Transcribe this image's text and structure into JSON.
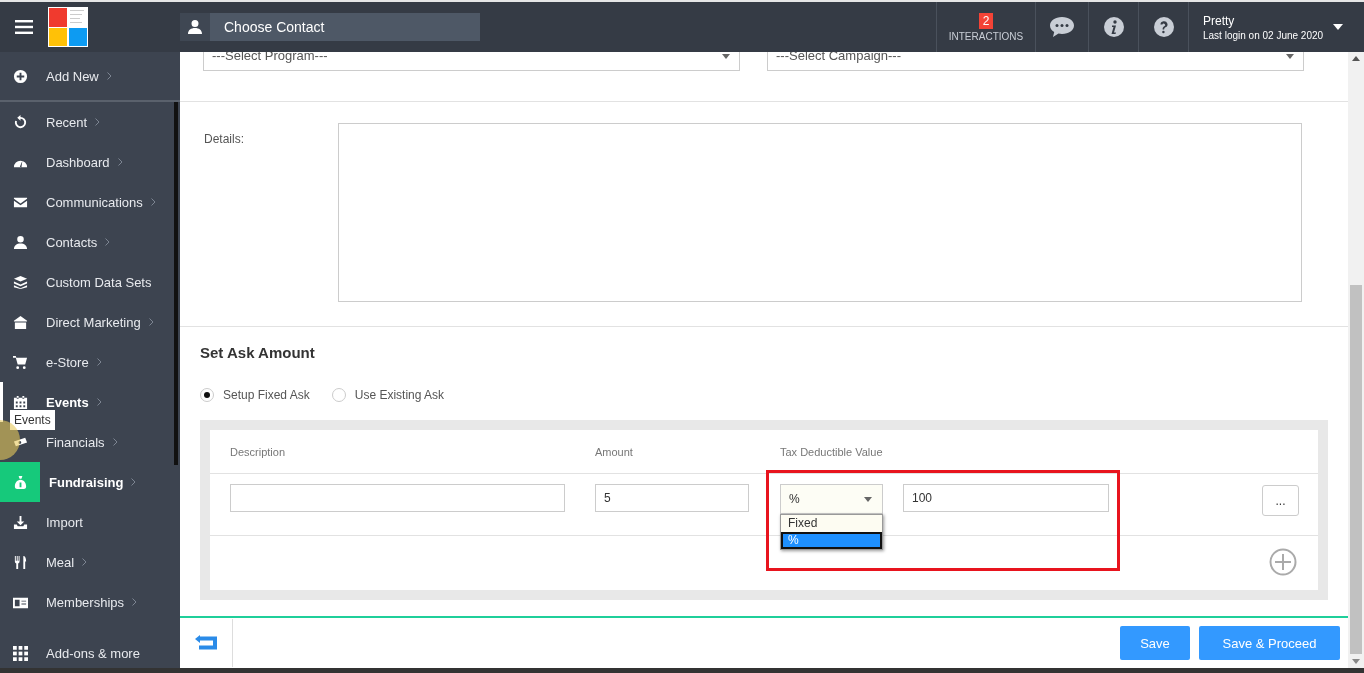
{
  "header": {
    "contact_placeholder": "Choose Contact",
    "interactions": {
      "count": "2",
      "label": "INTERACTIONS"
    },
    "user": {
      "name": "Pretty",
      "last_login": "Last login on 02 June 2020"
    }
  },
  "sidebar": {
    "items": [
      {
        "label": "Add New",
        "arrow": true,
        "selected": false,
        "hovered": false
      },
      {
        "label": "Recent",
        "arrow": true,
        "selected": false,
        "hovered": false
      },
      {
        "label": "Dashboard",
        "arrow": true,
        "selected": false,
        "hovered": false
      },
      {
        "label": "Communications",
        "arrow": true,
        "selected": false,
        "hovered": false
      },
      {
        "label": "Contacts",
        "arrow": true,
        "selected": false,
        "hovered": false
      },
      {
        "label": "Custom Data Sets",
        "arrow": false,
        "selected": false,
        "hovered": false
      },
      {
        "label": "Direct Marketing",
        "arrow": true,
        "selected": false,
        "hovered": false
      },
      {
        "label": "e-Store",
        "arrow": true,
        "selected": false,
        "hovered": false
      },
      {
        "label": "Events",
        "arrow": true,
        "selected": false,
        "hovered": true
      },
      {
        "label": "Financials",
        "arrow": true,
        "selected": false,
        "hovered": false
      },
      {
        "label": "Fundraising",
        "arrow": true,
        "selected": true,
        "hovered": false
      },
      {
        "label": "Import",
        "arrow": false,
        "selected": false,
        "hovered": false
      },
      {
        "label": "Meal",
        "arrow": true,
        "selected": false,
        "hovered": false
      },
      {
        "label": "Memberships",
        "arrow": true,
        "selected": false,
        "hovered": false
      }
    ],
    "tooltip": "Events",
    "bottom_item": "Add-ons & more"
  },
  "form": {
    "program_select": "---Select Program---",
    "campaign_select": "---Select Campaign---",
    "details_label": "Details:",
    "ask": {
      "title": "Set Ask Amount",
      "options": [
        {
          "label": "Setup Fixed Ask",
          "selected": true
        },
        {
          "label": "Use Existing Ask",
          "selected": false
        }
      ],
      "columns": [
        "Description",
        "Amount",
        "Tax Deductible Value"
      ],
      "row": {
        "amount": "5",
        "tax_type": "%",
        "tax_value": "100",
        "more_button": "..."
      },
      "tax_type_options": [
        {
          "label": "Fixed",
          "selected": false
        },
        {
          "label": "%",
          "selected": true
        }
      ]
    }
  },
  "footer": {
    "buttons": [
      "Save",
      "Save & Proceed"
    ]
  }
}
